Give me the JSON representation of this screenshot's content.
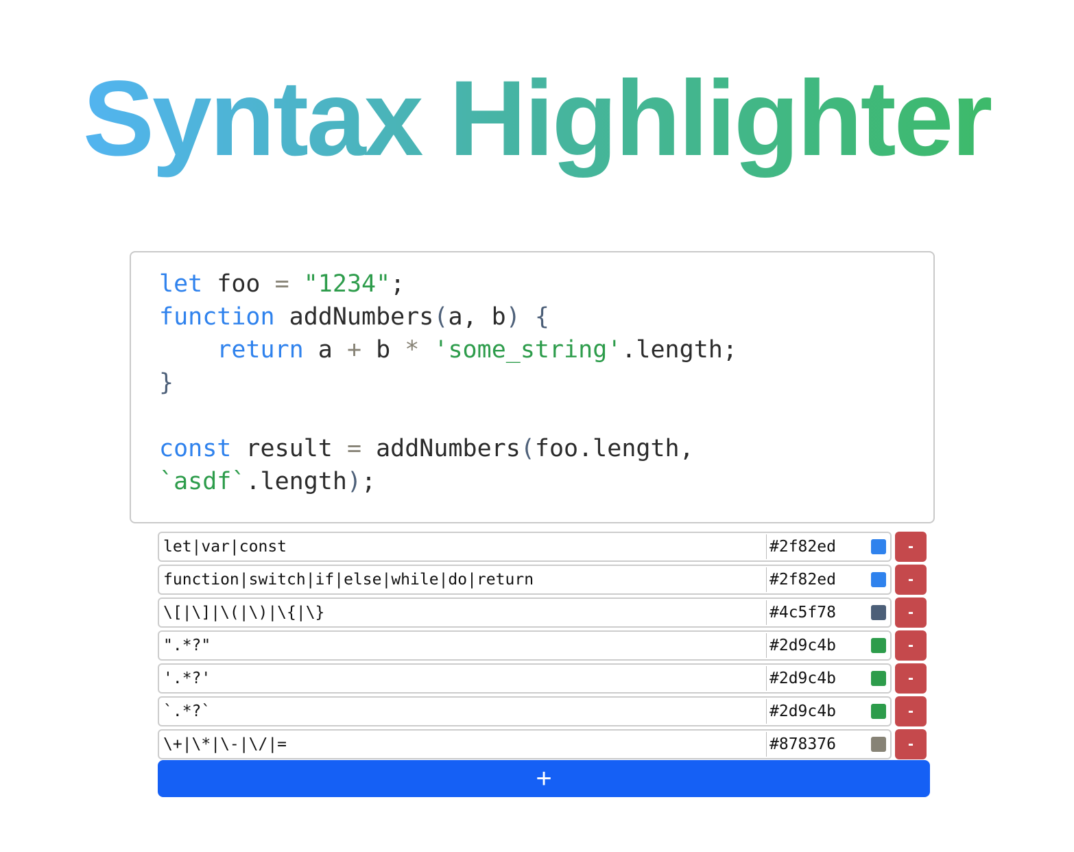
{
  "title": "Syntax Highlighter",
  "code_lines": [
    "let foo = \"1234\";",
    "function addNumbers(a, b) {",
    "    return a + b * 'some_string'.length;",
    "}",
    "",
    "const result = addNumbers(foo.length, `asdf`.length);"
  ],
  "rules": [
    {
      "pattern": "let|var|const",
      "color": "#2f82ed"
    },
    {
      "pattern": "function|switch|if|else|while|do|return",
      "color": "#2f82ed"
    },
    {
      "pattern": "\\[|\\]|\\(|\\)|\\{|\\}",
      "color": "#4c5f78"
    },
    {
      "pattern": "\".*?\"",
      "color": "#2d9c4b"
    },
    {
      "pattern": "'.*?'",
      "color": "#2d9c4b"
    },
    {
      "pattern": "`.*?`",
      "color": "#2d9c4b"
    },
    {
      "pattern": "\\+|\\*|\\-|\\/|=",
      "color": "#878376"
    }
  ],
  "remove_label": "-",
  "add_label": "+"
}
